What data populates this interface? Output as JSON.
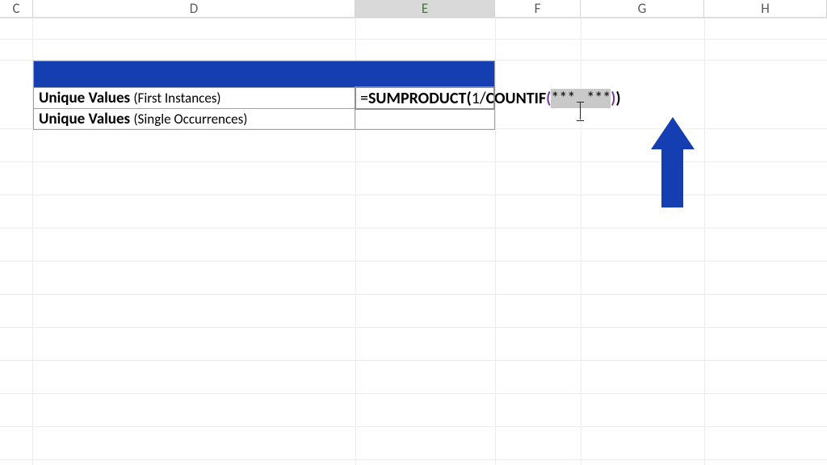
{
  "columns": {
    "C": "C",
    "D": "D",
    "E": "E",
    "F": "F",
    "G": "G",
    "H": "H"
  },
  "rows": {
    "label1_main": "Unique Values ",
    "label1_sub": "(First Instances)",
    "label2_main": "Unique Values ",
    "label2_sub": "(Single Occurrences)"
  },
  "formula": {
    "prefix": "=",
    "fn_outer": "SUMPRODUCT",
    "open_outer": "(",
    "one_slash": "1/",
    "fn_inner": "COUNTIF",
    "open_inner": "(",
    "arg_left": "***",
    "arg_sep": ",",
    "arg_right": "***",
    "close_inner": ")",
    "close_outer": ")"
  },
  "active_column": "E"
}
